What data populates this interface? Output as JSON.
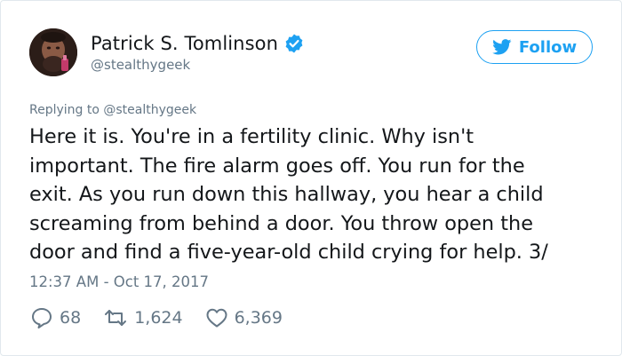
{
  "author": {
    "display_name": "Patrick S. Tomlinson",
    "handle": "@stealthygeek"
  },
  "follow_button": {
    "label": "Follow"
  },
  "reply_context": {
    "prefix": "Replying to",
    "mention": "@stealthygeek"
  },
  "tweet": {
    "lines": [
      "Here it is. You're in a fertility clinic. Why isn't",
      "important. The fire alarm goes off. You run for the",
      "exit. As you run down this hallway, you hear a child",
      "screaming from behind a door. You throw open the",
      "door and find a five-year-old child crying for help. 3/"
    ],
    "timestamp": "12:37 AM - Oct 17, 2017"
  },
  "stats": {
    "replies": "68",
    "retweets": "1,624",
    "likes": "6,369"
  },
  "colors": {
    "brand_blue": "#1da1f2",
    "secondary_text": "#657786",
    "primary_text": "#14171a",
    "border": "#e1e8ed"
  },
  "icons": {
    "avatar": "profile-photo",
    "verified": "verified-badge-icon",
    "follow": "twitter-bird-icon",
    "reply": "reply-bubble-icon",
    "retweet": "retweet-icon",
    "like": "heart-icon"
  }
}
